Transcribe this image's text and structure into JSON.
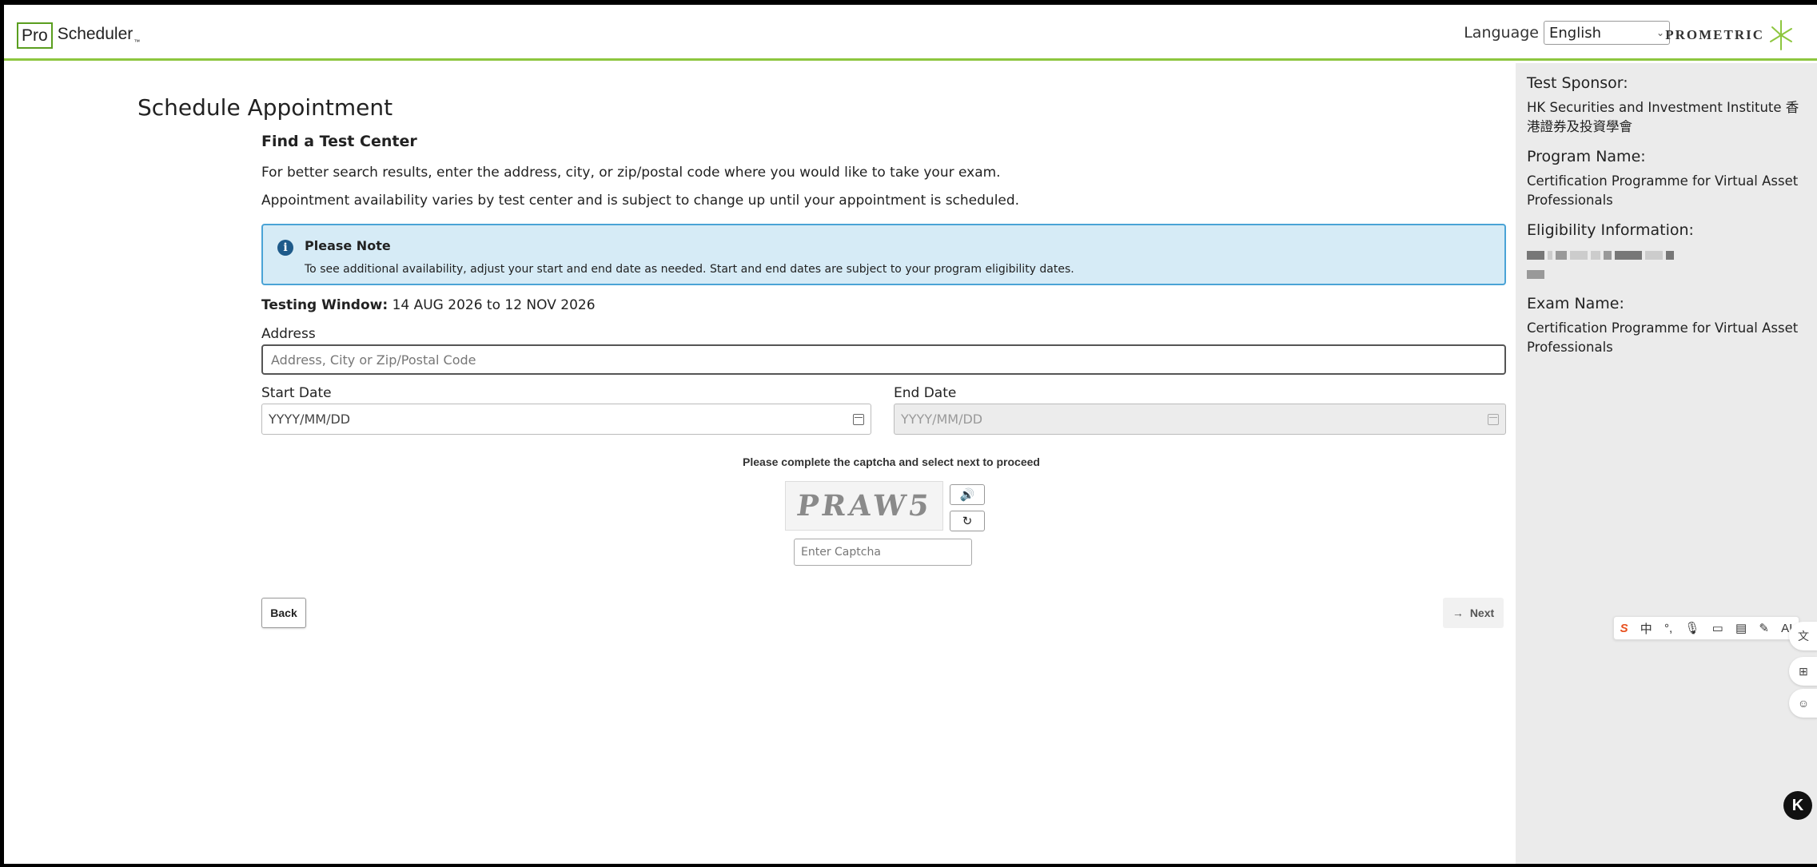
{
  "header": {
    "logo_pro": "Pro",
    "logo_scheduler": "Scheduler",
    "logo_tm": "™",
    "language_label": "Language",
    "language_value": "English",
    "brand": "PROMETRIC"
  },
  "main": {
    "title": "Schedule Appointment",
    "section_title": "Find a Test Center",
    "intro_1": "For better search results, enter the address, city, or zip/postal code where you would like to take your exam.",
    "intro_2": "Appointment availability varies by test center and is subject to change up until your appointment is scheduled.",
    "note": {
      "title": "Please Note",
      "body": "To see additional availability, adjust your start and end date as needed. Start and end dates are subject to your program eligibility dates."
    },
    "testing_window_label": "Testing Window:",
    "testing_window_value": "14 AUG 2026 to 12 NOV 2026",
    "address_label": "Address",
    "address_placeholder": "Address, City or Zip/Postal Code",
    "start_date_label": "Start Date",
    "start_date_placeholder": "YYYY/MM/DD",
    "end_date_label": "End Date",
    "end_date_placeholder": "YYYY/MM/DD",
    "captcha_message": "Please complete the captcha and select next to proceed",
    "captcha_text": "PRAW5",
    "captcha_input_placeholder": "Enter Captcha",
    "back_label": "Back",
    "next_label": "Next"
  },
  "sidebar": {
    "sponsor_label": "Test Sponsor:",
    "sponsor_value": "HK Securities and Investment Institute 香港證券及投資學會",
    "program_label": "Program Name:",
    "program_value": "Certification Programme for Virtual Asset Professionals",
    "eligibility_label": "Eligibility Information:",
    "exam_label": "Exam Name:",
    "exam_value": "Certification Programme for Virtual Asset Professionals"
  },
  "widgets": {
    "ime_zh": "中",
    "ai_label": "AI",
    "k_label": "K"
  },
  "colors": {
    "header_border": "#8dc63f",
    "note_bg": "#d6ebf6",
    "note_border": "#4aa3d6",
    "sidebar_bg": "#ebebeb"
  }
}
